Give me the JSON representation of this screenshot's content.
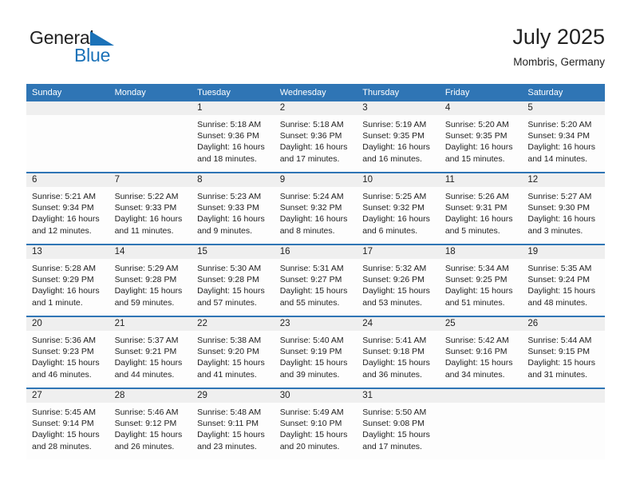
{
  "brand": {
    "name_part1": "General",
    "name_part2": "Blue",
    "flag_icon": "blue-flag-triangle",
    "accent_color": "#1b72b8"
  },
  "header": {
    "title": "July 2025",
    "location": "Mombris, Germany"
  },
  "colors": {
    "header_blue": "#2f75b5",
    "daynum_band": "#efefef",
    "cell_background": "#fdfdfd",
    "text": "#222222"
  },
  "weekday_headers": [
    "Sunday",
    "Monday",
    "Tuesday",
    "Wednesday",
    "Thursday",
    "Friday",
    "Saturday"
  ],
  "weeks": [
    [
      {
        "day": "",
        "sunrise": "",
        "sunset": "",
        "daylight_line1": "",
        "daylight_line2": "",
        "empty": true
      },
      {
        "day": "",
        "sunrise": "",
        "sunset": "",
        "daylight_line1": "",
        "daylight_line2": "",
        "empty": true
      },
      {
        "day": "1",
        "sunrise": "Sunrise: 5:18 AM",
        "sunset": "Sunset: 9:36 PM",
        "daylight_line1": "Daylight: 16 hours",
        "daylight_line2": "and 18 minutes."
      },
      {
        "day": "2",
        "sunrise": "Sunrise: 5:18 AM",
        "sunset": "Sunset: 9:36 PM",
        "daylight_line1": "Daylight: 16 hours",
        "daylight_line2": "and 17 minutes."
      },
      {
        "day": "3",
        "sunrise": "Sunrise: 5:19 AM",
        "sunset": "Sunset: 9:35 PM",
        "daylight_line1": "Daylight: 16 hours",
        "daylight_line2": "and 16 minutes."
      },
      {
        "day": "4",
        "sunrise": "Sunrise: 5:20 AM",
        "sunset": "Sunset: 9:35 PM",
        "daylight_line1": "Daylight: 16 hours",
        "daylight_line2": "and 15 minutes."
      },
      {
        "day": "5",
        "sunrise": "Sunrise: 5:20 AM",
        "sunset": "Sunset: 9:34 PM",
        "daylight_line1": "Daylight: 16 hours",
        "daylight_line2": "and 14 minutes."
      }
    ],
    [
      {
        "day": "6",
        "sunrise": "Sunrise: 5:21 AM",
        "sunset": "Sunset: 9:34 PM",
        "daylight_line1": "Daylight: 16 hours",
        "daylight_line2": "and 12 minutes."
      },
      {
        "day": "7",
        "sunrise": "Sunrise: 5:22 AM",
        "sunset": "Sunset: 9:33 PM",
        "daylight_line1": "Daylight: 16 hours",
        "daylight_line2": "and 11 minutes."
      },
      {
        "day": "8",
        "sunrise": "Sunrise: 5:23 AM",
        "sunset": "Sunset: 9:33 PM",
        "daylight_line1": "Daylight: 16 hours",
        "daylight_line2": "and 9 minutes."
      },
      {
        "day": "9",
        "sunrise": "Sunrise: 5:24 AM",
        "sunset": "Sunset: 9:32 PM",
        "daylight_line1": "Daylight: 16 hours",
        "daylight_line2": "and 8 minutes."
      },
      {
        "day": "10",
        "sunrise": "Sunrise: 5:25 AM",
        "sunset": "Sunset: 9:32 PM",
        "daylight_line1": "Daylight: 16 hours",
        "daylight_line2": "and 6 minutes."
      },
      {
        "day": "11",
        "sunrise": "Sunrise: 5:26 AM",
        "sunset": "Sunset: 9:31 PM",
        "daylight_line1": "Daylight: 16 hours",
        "daylight_line2": "and 5 minutes."
      },
      {
        "day": "12",
        "sunrise": "Sunrise: 5:27 AM",
        "sunset": "Sunset: 9:30 PM",
        "daylight_line1": "Daylight: 16 hours",
        "daylight_line2": "and 3 minutes."
      }
    ],
    [
      {
        "day": "13",
        "sunrise": "Sunrise: 5:28 AM",
        "sunset": "Sunset: 9:29 PM",
        "daylight_line1": "Daylight: 16 hours",
        "daylight_line2": "and 1 minute."
      },
      {
        "day": "14",
        "sunrise": "Sunrise: 5:29 AM",
        "sunset": "Sunset: 9:28 PM",
        "daylight_line1": "Daylight: 15 hours",
        "daylight_line2": "and 59 minutes."
      },
      {
        "day": "15",
        "sunrise": "Sunrise: 5:30 AM",
        "sunset": "Sunset: 9:28 PM",
        "daylight_line1": "Daylight: 15 hours",
        "daylight_line2": "and 57 minutes."
      },
      {
        "day": "16",
        "sunrise": "Sunrise: 5:31 AM",
        "sunset": "Sunset: 9:27 PM",
        "daylight_line1": "Daylight: 15 hours",
        "daylight_line2": "and 55 minutes."
      },
      {
        "day": "17",
        "sunrise": "Sunrise: 5:32 AM",
        "sunset": "Sunset: 9:26 PM",
        "daylight_line1": "Daylight: 15 hours",
        "daylight_line2": "and 53 minutes."
      },
      {
        "day": "18",
        "sunrise": "Sunrise: 5:34 AM",
        "sunset": "Sunset: 9:25 PM",
        "daylight_line1": "Daylight: 15 hours",
        "daylight_line2": "and 51 minutes."
      },
      {
        "day": "19",
        "sunrise": "Sunrise: 5:35 AM",
        "sunset": "Sunset: 9:24 PM",
        "daylight_line1": "Daylight: 15 hours",
        "daylight_line2": "and 48 minutes."
      }
    ],
    [
      {
        "day": "20",
        "sunrise": "Sunrise: 5:36 AM",
        "sunset": "Sunset: 9:23 PM",
        "daylight_line1": "Daylight: 15 hours",
        "daylight_line2": "and 46 minutes."
      },
      {
        "day": "21",
        "sunrise": "Sunrise: 5:37 AM",
        "sunset": "Sunset: 9:21 PM",
        "daylight_line1": "Daylight: 15 hours",
        "daylight_line2": "and 44 minutes."
      },
      {
        "day": "22",
        "sunrise": "Sunrise: 5:38 AM",
        "sunset": "Sunset: 9:20 PM",
        "daylight_line1": "Daylight: 15 hours",
        "daylight_line2": "and 41 minutes."
      },
      {
        "day": "23",
        "sunrise": "Sunrise: 5:40 AM",
        "sunset": "Sunset: 9:19 PM",
        "daylight_line1": "Daylight: 15 hours",
        "daylight_line2": "and 39 minutes."
      },
      {
        "day": "24",
        "sunrise": "Sunrise: 5:41 AM",
        "sunset": "Sunset: 9:18 PM",
        "daylight_line1": "Daylight: 15 hours",
        "daylight_line2": "and 36 minutes."
      },
      {
        "day": "25",
        "sunrise": "Sunrise: 5:42 AM",
        "sunset": "Sunset: 9:16 PM",
        "daylight_line1": "Daylight: 15 hours",
        "daylight_line2": "and 34 minutes."
      },
      {
        "day": "26",
        "sunrise": "Sunrise: 5:44 AM",
        "sunset": "Sunset: 9:15 PM",
        "daylight_line1": "Daylight: 15 hours",
        "daylight_line2": "and 31 minutes."
      }
    ],
    [
      {
        "day": "27",
        "sunrise": "Sunrise: 5:45 AM",
        "sunset": "Sunset: 9:14 PM",
        "daylight_line1": "Daylight: 15 hours",
        "daylight_line2": "and 28 minutes."
      },
      {
        "day": "28",
        "sunrise": "Sunrise: 5:46 AM",
        "sunset": "Sunset: 9:12 PM",
        "daylight_line1": "Daylight: 15 hours",
        "daylight_line2": "and 26 minutes."
      },
      {
        "day": "29",
        "sunrise": "Sunrise: 5:48 AM",
        "sunset": "Sunset: 9:11 PM",
        "daylight_line1": "Daylight: 15 hours",
        "daylight_line2": "and 23 minutes."
      },
      {
        "day": "30",
        "sunrise": "Sunrise: 5:49 AM",
        "sunset": "Sunset: 9:10 PM",
        "daylight_line1": "Daylight: 15 hours",
        "daylight_line2": "and 20 minutes."
      },
      {
        "day": "31",
        "sunrise": "Sunrise: 5:50 AM",
        "sunset": "Sunset: 9:08 PM",
        "daylight_line1": "Daylight: 15 hours",
        "daylight_line2": "and 17 minutes."
      },
      {
        "day": "",
        "sunrise": "",
        "sunset": "",
        "daylight_line1": "",
        "daylight_line2": "",
        "empty": true
      },
      {
        "day": "",
        "sunrise": "",
        "sunset": "",
        "daylight_line1": "",
        "daylight_line2": "",
        "empty": true
      }
    ]
  ]
}
